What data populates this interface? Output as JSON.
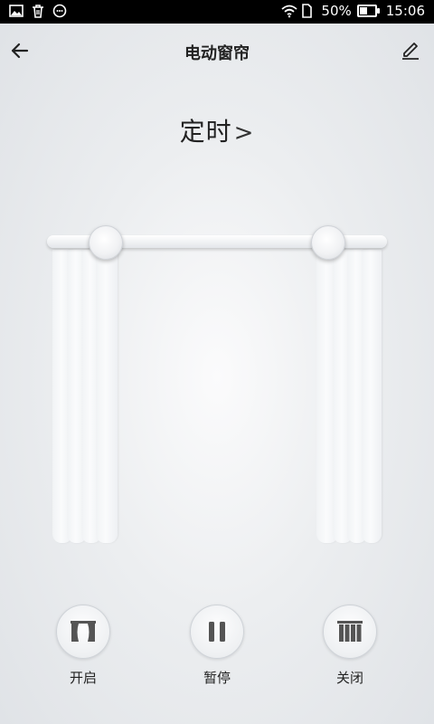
{
  "status_bar": {
    "battery_percent": "50%",
    "battery_level": 0.5,
    "time": "15:06",
    "left_icons": [
      "image-icon",
      "trash-icon",
      "chat-bubble-icon"
    ],
    "right_icons": [
      "wifi-icon",
      "sim-icon",
      "battery-icon"
    ]
  },
  "app_bar": {
    "title": "电动窗帘",
    "back_icon": "arrow-left-icon",
    "edit_icon": "pencil-icon"
  },
  "timer": {
    "label": "定时",
    "chevron": ">"
  },
  "curtain": {
    "left_open_fraction": 0.2,
    "right_open_fraction": 0.2
  },
  "controls": [
    {
      "label": "开启",
      "icon": "curtain-open-icon"
    },
    {
      "label": "暂停",
      "icon": "pause-icon"
    },
    {
      "label": "关闭",
      "icon": "curtain-close-icon"
    }
  ],
  "colors": {
    "text": "#222222",
    "status_bar_bg": "#000000"
  }
}
